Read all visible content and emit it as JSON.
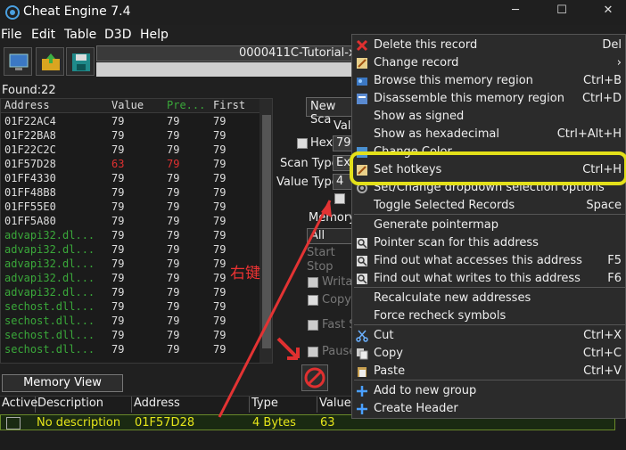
{
  "window": {
    "title": "Cheat Engine 7.4",
    "minimize": "─",
    "maximize": "☐",
    "close": "✕"
  },
  "menu": [
    "File",
    "Edit",
    "Table",
    "D3D",
    "Help"
  ],
  "process": {
    "name": "0000411C-Tutorial-x8"
  },
  "found": "Found:22",
  "results": {
    "columns": [
      "Address",
      "Value",
      "Pre...",
      "First"
    ],
    "rows": [
      {
        "address": "01F22AC4",
        "value": "79",
        "previous": "79",
        "first": "79",
        "changed": false,
        "module": false
      },
      {
        "address": "01F22BA8",
        "value": "79",
        "previous": "79",
        "first": "79",
        "changed": false,
        "module": false
      },
      {
        "address": "01F22C2C",
        "value": "79",
        "previous": "79",
        "first": "79",
        "changed": false,
        "module": false
      },
      {
        "address": "01F57D28",
        "value": "63",
        "previous": "79",
        "first": "79",
        "changed": true,
        "module": false
      },
      {
        "address": "01FF4330",
        "value": "79",
        "previous": "79",
        "first": "79",
        "changed": false,
        "module": false
      },
      {
        "address": "01FF48B8",
        "value": "79",
        "previous": "79",
        "first": "79",
        "changed": false,
        "module": false
      },
      {
        "address": "01FF55E0",
        "value": "79",
        "previous": "79",
        "first": "79",
        "changed": false,
        "module": false
      },
      {
        "address": "01FF5A80",
        "value": "79",
        "previous": "79",
        "first": "79",
        "changed": false,
        "module": false
      },
      {
        "address": "advapi32.dl...",
        "value": "79",
        "previous": "79",
        "first": "79",
        "changed": false,
        "module": true
      },
      {
        "address": "advapi32.dl...",
        "value": "79",
        "previous": "79",
        "first": "79",
        "changed": false,
        "module": true
      },
      {
        "address": "advapi32.dl...",
        "value": "79",
        "previous": "79",
        "first": "79",
        "changed": false,
        "module": true
      },
      {
        "address": "advapi32.dl...",
        "value": "79",
        "previous": "79",
        "first": "79",
        "changed": false,
        "module": true
      },
      {
        "address": "advapi32.dl...",
        "value": "79",
        "previous": "79",
        "first": "79",
        "changed": false,
        "module": true
      },
      {
        "address": "sechost.dll...",
        "value": "79",
        "previous": "79",
        "first": "79",
        "changed": false,
        "module": true
      },
      {
        "address": "sechost.dll...",
        "value": "79",
        "previous": "79",
        "first": "79",
        "changed": false,
        "module": true
      },
      {
        "address": "sechost.dll...",
        "value": "79",
        "previous": "79",
        "first": "79",
        "changed": false,
        "module": true
      },
      {
        "address": "sechost.dll...",
        "value": "79",
        "previous": "79",
        "first": "79",
        "changed": false,
        "module": true
      }
    ]
  },
  "scan": {
    "new_scan": "New Sca",
    "value_label": "Valu",
    "hex_label": "Hex",
    "value_input": "79",
    "scan_type_label": "Scan Type",
    "scan_type_value": "Ex",
    "value_type_label": "Value Type",
    "value_type_value": "4",
    "memory_label": "Memory",
    "memory_all": "All",
    "start_label": "Start",
    "stop_label": "Stop",
    "writable": "Writa",
    "copy_on_write": "Copy",
    "fast_scan": "Fast S",
    "pause": "Pause"
  },
  "memory_view": "Memory View",
  "address_list": {
    "columns": [
      "Active",
      "Description",
      "Address",
      "Type",
      "Value"
    ],
    "rows": [
      {
        "description": "No description",
        "address": "01F57D28",
        "type": "4 Bytes",
        "value": "63"
      }
    ]
  },
  "context_menu": [
    {
      "label": "Delete this record",
      "shortcut": "Del",
      "icon": "delete-x-icon"
    },
    {
      "label": "Change record",
      "shortcut": "›",
      "icon": "pencil-icon"
    },
    {
      "label": "Browse this memory region",
      "shortcut": "Ctrl+B",
      "icon": "memory-browse-icon"
    },
    {
      "label": "Disassemble this memory region",
      "shortcut": "Ctrl+D",
      "icon": "disassemble-icon"
    },
    {
      "label": "Show as signed",
      "shortcut": "",
      "icon": ""
    },
    {
      "label": "Show as hexadecimal",
      "shortcut": "Ctrl+Alt+H",
      "icon": ""
    },
    {
      "label": "Change Color",
      "shortcut": "",
      "icon": "color-icon"
    },
    {
      "label": "Set hotkeys",
      "shortcut": "Ctrl+H",
      "icon": "hotkey-icon"
    },
    {
      "label": "Set/Change dropdown selection options",
      "shortcut": "",
      "icon": "gear-icon"
    },
    {
      "label": "Toggle Selected Records",
      "shortcut": "Space",
      "icon": ""
    },
    {
      "label": "Generate pointermap",
      "shortcut": "",
      "icon": ""
    },
    {
      "label": "Pointer scan for this address",
      "shortcut": "",
      "icon": "magnifier-icon"
    },
    {
      "label": "Find out what accesses this address",
      "shortcut": "F5",
      "icon": "magnifier-icon"
    },
    {
      "label": "Find out what writes to this address",
      "shortcut": "F6",
      "icon": "magnifier-icon"
    },
    {
      "label": "Recalculate new addresses",
      "shortcut": "",
      "icon": ""
    },
    {
      "label": "Force recheck symbols",
      "shortcut": "",
      "icon": ""
    },
    {
      "label": "Cut",
      "shortcut": "Ctrl+X",
      "icon": "scissors-icon"
    },
    {
      "label": "Copy",
      "shortcut": "Ctrl+C",
      "icon": "copy-icon"
    },
    {
      "label": "Paste",
      "shortcut": "Ctrl+V",
      "icon": "paste-icon"
    },
    {
      "label": "Add to new group",
      "shortcut": "",
      "icon": "plus-icon"
    },
    {
      "label": "Create Header",
      "shortcut": "",
      "icon": "plus-icon"
    }
  ],
  "annotation": "右键",
  "colors": {
    "accent_yellow": "#e3e01a",
    "annotation_red": "#e33333",
    "changed_value": "#e03030",
    "module_green": "#3aa83a",
    "record_yellow": "#e6e61a"
  }
}
